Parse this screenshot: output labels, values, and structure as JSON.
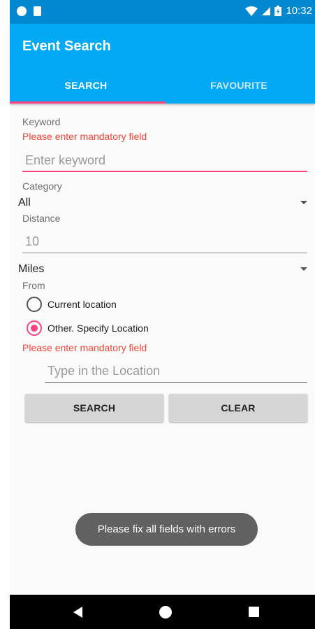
{
  "statusbar": {
    "time": "10:32",
    "icons": [
      "notification-icon",
      "sd-card-icon",
      "wifi-icon",
      "signal-icon",
      "battery-charging-icon"
    ]
  },
  "appbar": {
    "title": "Event Search"
  },
  "tabs": [
    {
      "label": "SEARCH",
      "active": true
    },
    {
      "label": "FAVOURITE",
      "active": false
    }
  ],
  "form": {
    "keyword": {
      "label": "Keyword",
      "error": "Please enter mandatory field",
      "placeholder": "Enter keyword",
      "value": ""
    },
    "category": {
      "label": "Category",
      "selected": "All"
    },
    "distance": {
      "label": "Distance",
      "placeholder": "10",
      "value": ""
    },
    "units": {
      "selected": "Miles"
    },
    "from": {
      "label": "From",
      "options": [
        {
          "label": "Current location",
          "checked": false
        },
        {
          "label": "Other. Specify Location",
          "checked": true
        }
      ],
      "error": "Please enter mandatory field",
      "location_placeholder": "Type in the Location",
      "location_value": ""
    }
  },
  "buttons": {
    "search": "SEARCH",
    "clear": "CLEAR"
  },
  "toast": "Please fix all fields with errors",
  "navbar": {
    "icons": [
      "back-icon",
      "home-icon",
      "recents-icon"
    ]
  },
  "colors": {
    "primary": "#03a9f4",
    "primary_dark": "#0288d1",
    "accent": "#ff4081",
    "error": "#f44336"
  }
}
